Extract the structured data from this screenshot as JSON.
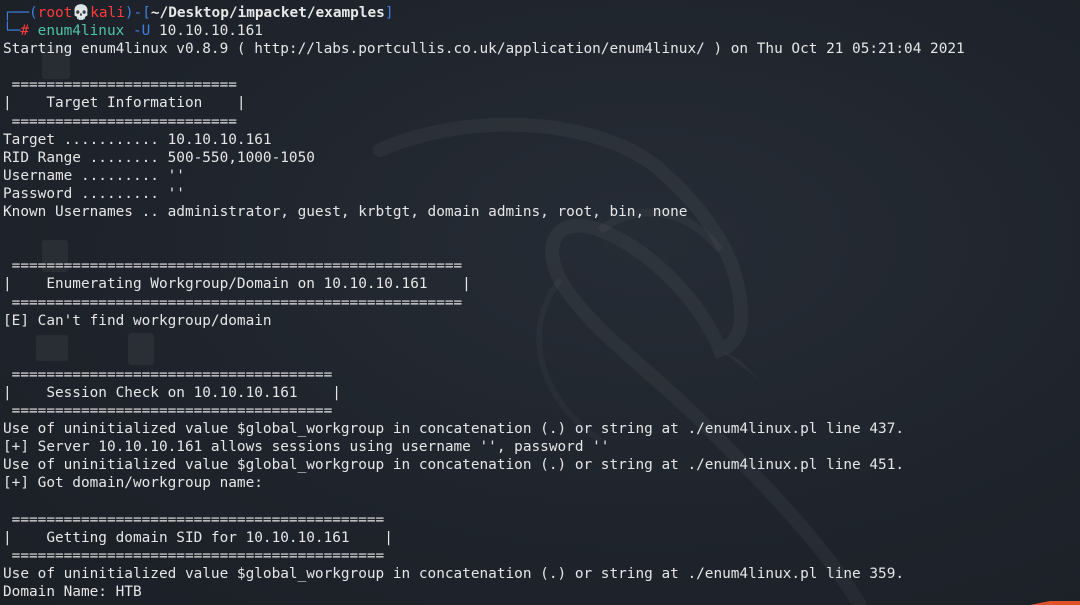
{
  "prompt": {
    "corner_top": "┌──(",
    "user": "root",
    "skull": "💀",
    "host": "kali",
    "mid": ")-[",
    "path": "~/Desktop/impacket/examples",
    "end": "]",
    "corner_bottom": "└─",
    "hash": "# ",
    "command": "enum4linux",
    "flag": " -U",
    "argument": " 10.10.10.161"
  },
  "output_lines": [
    "Starting enum4linux v0.8.9 ( http://labs.portcullis.co.uk/application/enum4linux/ ) on Thu Oct 21 05:21:04 2021",
    "",
    " ==========================",
    "|    Target Information    |",
    " ==========================",
    "Target ........... 10.10.10.161",
    "RID Range ........ 500-550,1000-1050",
    "Username ......... ''",
    "Password ......... ''",
    "Known Usernames .. administrator, guest, krbtgt, domain admins, root, bin, none",
    "",
    "",
    " ====================================================",
    "|    Enumerating Workgroup/Domain on 10.10.10.161    |",
    " ====================================================",
    "[E] Can't find workgroup/domain",
    "",
    "",
    " =====================================",
    "|    Session Check on 10.10.10.161    |",
    " =====================================",
    "Use of uninitialized value $global_workgroup in concatenation (.) or string at ./enum4linux.pl line 437.",
    "[+] Server 10.10.10.161 allows sessions using username '', password ''",
    "Use of uninitialized value $global_workgroup in concatenation (.) or string at ./enum4linux.pl line 451.",
    "[+] Got domain/workgroup name: ",
    "",
    " ===========================================",
    "|    Getting domain SID for 10.10.10.161    |",
    " ===========================================",
    "Use of uninitialized value $global_workgroup in concatenation (.) or string at ./enum4linux.pl line 359.",
    "Domain Name: HTB"
  ],
  "colors": {
    "background": "#1f242c",
    "text": "#e6e6e6",
    "prompt_frame": "#3f7fe0",
    "prompt_user_host": "#ff3c3c",
    "command": "#4fc3a8",
    "accent_corner": "#e0522a"
  },
  "icons": [
    "kali-dragon-watermark-icon",
    "desktop-file-icon"
  ]
}
